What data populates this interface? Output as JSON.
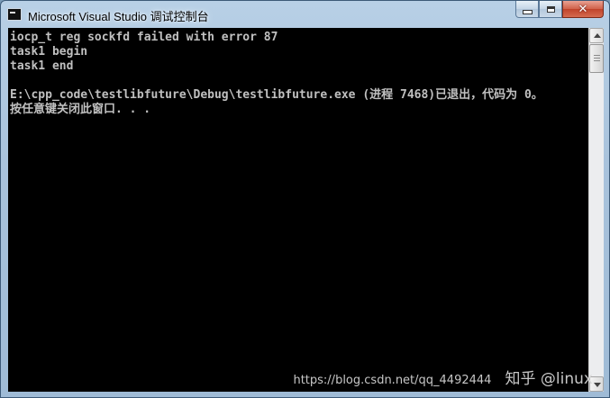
{
  "window": {
    "title": "Microsoft Visual Studio 调试控制台"
  },
  "controls": {
    "minimize_icon": "minimize-icon",
    "maximize_icon": "maximize-icon",
    "close_icon": "close-icon",
    "close_glyph": "✕"
  },
  "console": {
    "lines": [
      "iocp_t reg sockfd failed with error 87",
      "task1 begin",
      "task1 end",
      "",
      "E:\\cpp_code\\testlibfuture\\Debug\\testlibfuture.exe (进程 7468)已退出，代码为 0。",
      "按任意键关闭此窗口. . ."
    ],
    "text_color": "#c0c0c0",
    "background": "#000000"
  },
  "watermark": {
    "url": "https://blog.csdn.net/qq_4492444",
    "brand": "知乎 @linux"
  }
}
